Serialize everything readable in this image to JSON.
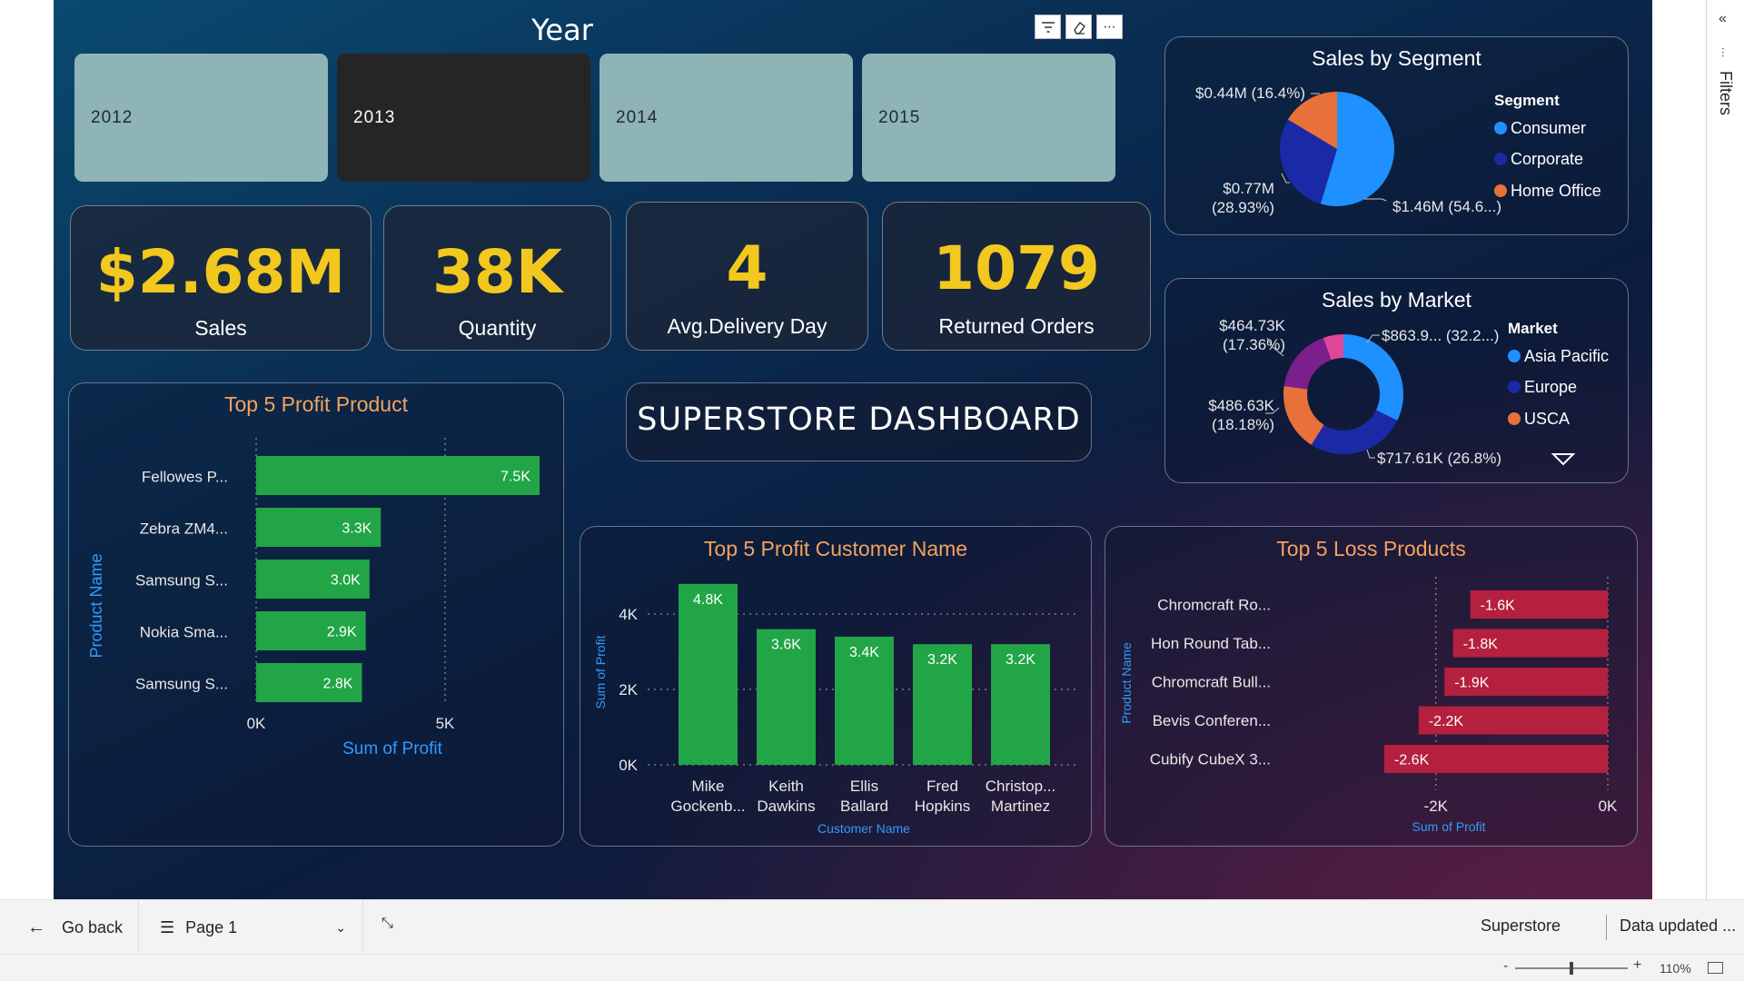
{
  "slicer": {
    "title": "Year",
    "years": [
      "2012",
      "2013",
      "2014",
      "2015"
    ],
    "selected": "2013"
  },
  "kpis": [
    {
      "value": "$2.68M",
      "label": "Sales"
    },
    {
      "value": "38K",
      "label": "Quantity"
    },
    {
      "value": "4",
      "label": "Avg.Delivery Day"
    },
    {
      "value": "1079",
      "label": "Returned Orders"
    }
  ],
  "dashboard_title": "SUPERSTORE DASHBOARD",
  "visual_header_icons": [
    "filter-icon",
    "eraser-icon",
    "more-options-icon"
  ],
  "colors": {
    "kpi_value": "#f2c81e",
    "bar_green": "#22a547",
    "bar_red": "#b5203f",
    "axis_title": "#2f9bff",
    "chart_title": "#f4a25f",
    "consumer": "#1e90ff",
    "corporate": "#1a2aa6",
    "home_office": "#e8713a",
    "asia_pacific": "#1e90ff",
    "europe": "#1a2aa6",
    "usca": "#e8713a",
    "market_extra_1": "#7a1f8c",
    "market_extra_2": "#e0469a"
  },
  "chart_data": [
    {
      "id": "top5-profit-product",
      "type": "bar",
      "orientation": "horizontal",
      "title": "Top 5 Profit Product",
      "xlabel": "Sum of Profit",
      "ylabel": "Product Name",
      "categories": [
        "Fellowes P...",
        "Zebra ZM4...",
        "Samsung S...",
        "Nokia Sma...",
        "Samsung S..."
      ],
      "values": [
        7.5,
        3.3,
        3.0,
        2.9,
        2.8
      ],
      "data_labels": [
        "7.5K",
        "3.3K",
        "3.0K",
        "2.9K",
        "2.8K"
      ],
      "value_unit": "K",
      "xlim": [
        0,
        8
      ],
      "xticks": [
        0,
        5
      ],
      "xtick_labels": [
        "0K",
        "5K"
      ]
    },
    {
      "id": "top5-profit-customer",
      "type": "bar",
      "orientation": "vertical",
      "title": "Top 5 Profit Customer Name",
      "xlabel": "Customer Name",
      "ylabel": "Sum of Profit",
      "categories": [
        [
          "Mike",
          "Gockenb..."
        ],
        [
          "Keith",
          "Dawkins"
        ],
        [
          "Ellis",
          "Ballard"
        ],
        [
          "Fred",
          "Hopkins"
        ],
        [
          "Christop...",
          "Martinez"
        ]
      ],
      "values": [
        4.8,
        3.6,
        3.4,
        3.2,
        3.2
      ],
      "data_labels": [
        "4.8K",
        "3.6K",
        "3.4K",
        "3.2K",
        "3.2K"
      ],
      "value_unit": "K",
      "ylim": [
        0,
        4.8
      ],
      "yticks": [
        0,
        2,
        4
      ],
      "ytick_labels": [
        "0K",
        "2K",
        "4K"
      ]
    },
    {
      "id": "top5-loss-products",
      "type": "bar",
      "orientation": "horizontal",
      "title": "Top 5 Loss Products",
      "xlabel": "Sum of Profit",
      "ylabel": "Product Name",
      "categories": [
        "Chromcraft Ro...",
        "Hon Round Tab...",
        "Chromcraft Bull...",
        "Bevis Conferen...",
        "Cubify CubeX 3..."
      ],
      "values": [
        -1.6,
        -1.8,
        -1.9,
        -2.2,
        -2.6
      ],
      "data_labels": [
        "-1.6K",
        "-1.8K",
        "-1.9K",
        "-2.2K",
        "-2.6K"
      ],
      "value_unit": "K",
      "xlim": [
        -2.6,
        0
      ],
      "xticks": [
        -2,
        0
      ],
      "xtick_labels": [
        "-2K",
        "0K"
      ]
    },
    {
      "id": "sales-by-segment",
      "type": "pie",
      "title": "Sales by Segment",
      "legend_title": "Segment",
      "legend_position": "right",
      "categories": [
        "Consumer",
        "Corporate",
        "Home Office"
      ],
      "values": [
        54.6,
        28.93,
        16.4
      ],
      "value_unit": "%",
      "data_labels": [
        "$1.46M (54.6...)",
        [
          "$0.77M",
          "(28.93%)"
        ],
        "$0.44M (16.4%)"
      ]
    },
    {
      "id": "sales-by-market",
      "type": "pie",
      "variant": "donut",
      "title": "Sales by Market",
      "legend_title": "Market",
      "legend_position": "right",
      "categories": [
        "Asia Pacific",
        "Europe",
        "USCA"
      ],
      "values": [
        32.2,
        26.8,
        18.18,
        17.36,
        5.46
      ],
      "value_unit": "%",
      "data_labels": [
        "$863.9... (32.2...)",
        "$717.61K (26.8%)",
        [
          "$486.63K",
          "(18.18%)"
        ],
        [
          "$464.73K",
          "(17.36%)"
        ]
      ]
    }
  ],
  "footer": {
    "go_back": "Go back",
    "page": "Page 1",
    "report_name": "Superstore",
    "data_updated": "Data updated ..."
  },
  "statusbar": {
    "zoom": "110%"
  },
  "filters_pane": {
    "label": "Filters"
  }
}
